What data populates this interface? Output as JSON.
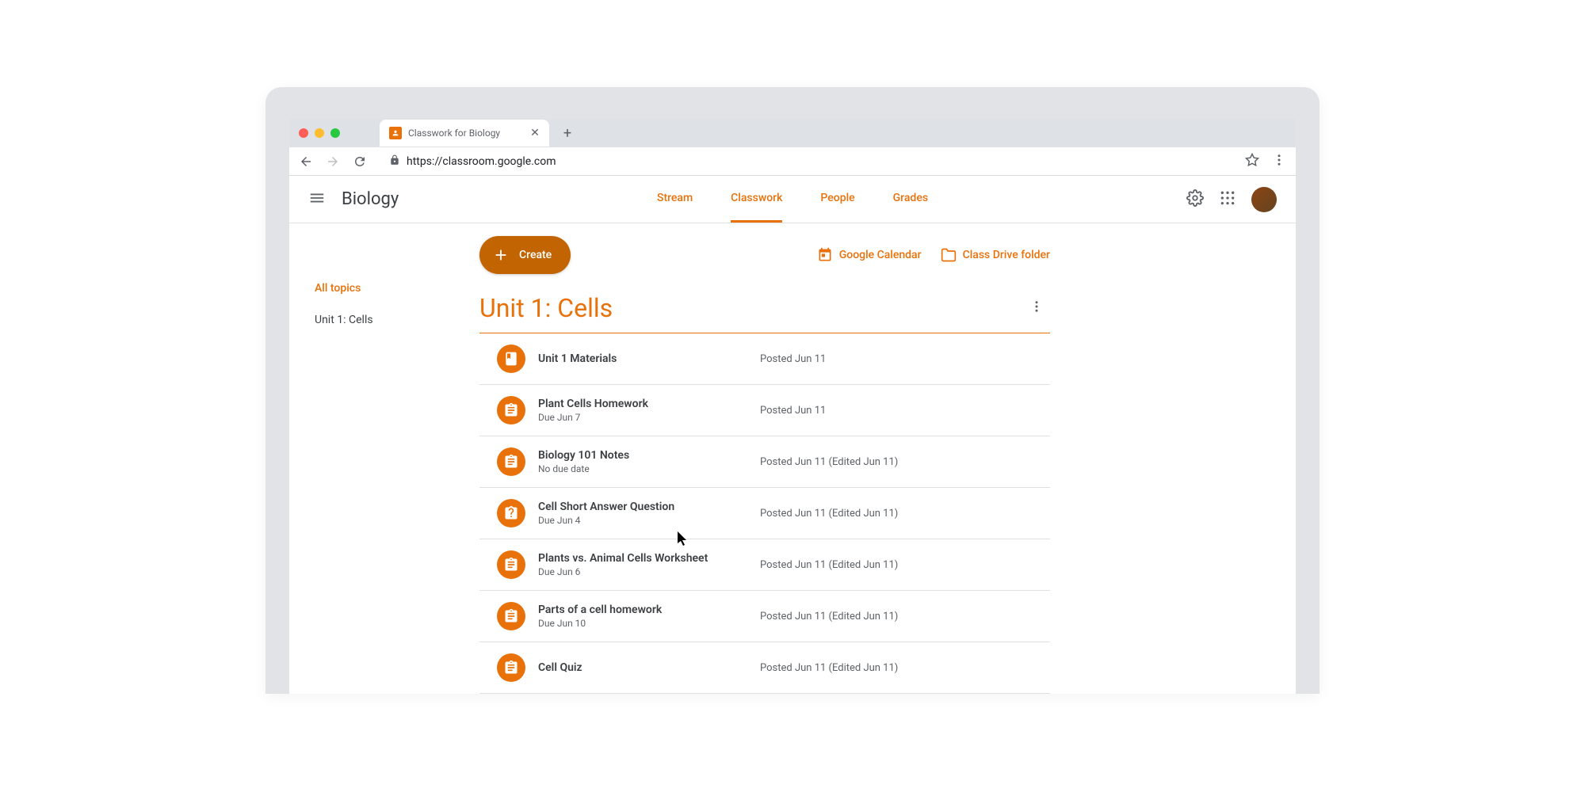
{
  "browser": {
    "tab_title": "Classwork for Biology",
    "url": "https://classroom.google.com"
  },
  "header": {
    "class_name": "Biology",
    "tabs": [
      "Stream",
      "Classwork",
      "People",
      "Grades"
    ]
  },
  "sidebar": {
    "all_topics": "All topics",
    "topics": [
      "Unit 1: Cells"
    ]
  },
  "actions": {
    "create": "Create",
    "calendar": "Google Calendar",
    "drive": "Class Drive folder"
  },
  "section": {
    "title": "Unit 1: Cells"
  },
  "assignments": [
    {
      "icon": "book",
      "title": "Unit 1 Materials",
      "due": "",
      "posted": "Posted Jun 11"
    },
    {
      "icon": "clipboard",
      "title": "Plant Cells Homework",
      "due": "Due Jun 7",
      "posted": "Posted Jun 11"
    },
    {
      "icon": "clipboard",
      "title": "Biology 101 Notes",
      "due": "No due date",
      "posted": "Posted Jun 11 (Edited Jun 11)"
    },
    {
      "icon": "question",
      "title": "Cell Short Answer Question",
      "due": "Due Jun 4",
      "posted": "Posted Jun 11 (Edited Jun 11)"
    },
    {
      "icon": "clipboard",
      "title": "Plants vs. Animal Cells Worksheet",
      "due": "Due Jun 6",
      "posted": "Posted Jun 11 (Edited Jun 11)"
    },
    {
      "icon": "clipboard",
      "title": "Parts of a cell homework",
      "due": "Due Jun 10",
      "posted": "Posted Jun 11 (Edited Jun 11)"
    },
    {
      "icon": "clipboard",
      "title": "Cell Quiz",
      "due": "",
      "posted": "Posted Jun 11 (Edited Jun 11)"
    }
  ]
}
